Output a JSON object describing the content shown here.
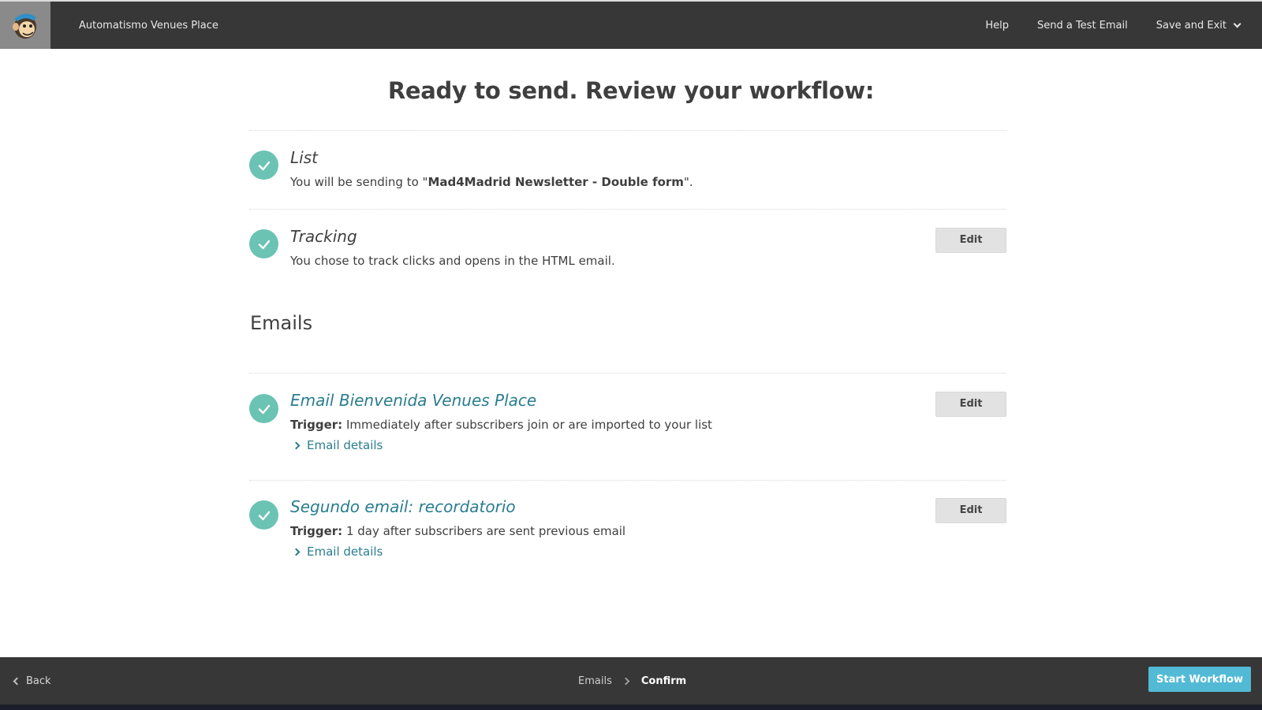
{
  "header": {
    "app_title": "Automatismo Venues Place",
    "nav": {
      "help": "Help",
      "test_email": "Send a Test Email",
      "save_exit": "Save and Exit"
    }
  },
  "main": {
    "page_title": "Ready to send. Review your workflow:",
    "list_section": {
      "title": "List",
      "desc_prefix": "You will be sending to \"",
      "list_name": "Mad4Madrid Newsletter - Double form",
      "desc_suffix": "\"."
    },
    "tracking_section": {
      "title": "Tracking",
      "desc": "You chose to track clicks and opens in the HTML email.",
      "edit_label": "Edit"
    },
    "emails_heading": "Emails",
    "emails": [
      {
        "title": "Email Bienvenida Venues Place",
        "trigger_label": "Trigger:",
        "trigger_text": " Immediately after subscribers join or are imported to your list",
        "details_label": "Email details",
        "edit_label": "Edit"
      },
      {
        "title": "Segundo email: recordatorio",
        "trigger_label": "Trigger:",
        "trigger_text": " 1 day after subscribers are sent previous email",
        "details_label": "Email details",
        "edit_label": "Edit"
      }
    ]
  },
  "footer": {
    "back_label": "Back",
    "steps": [
      "Emails",
      "Confirm"
    ],
    "start_label": "Start Workflow"
  },
  "colors": {
    "accent": "#52bad5",
    "check": "#6bc3b3",
    "link": "#2a7d8f",
    "bar": "#373737"
  }
}
